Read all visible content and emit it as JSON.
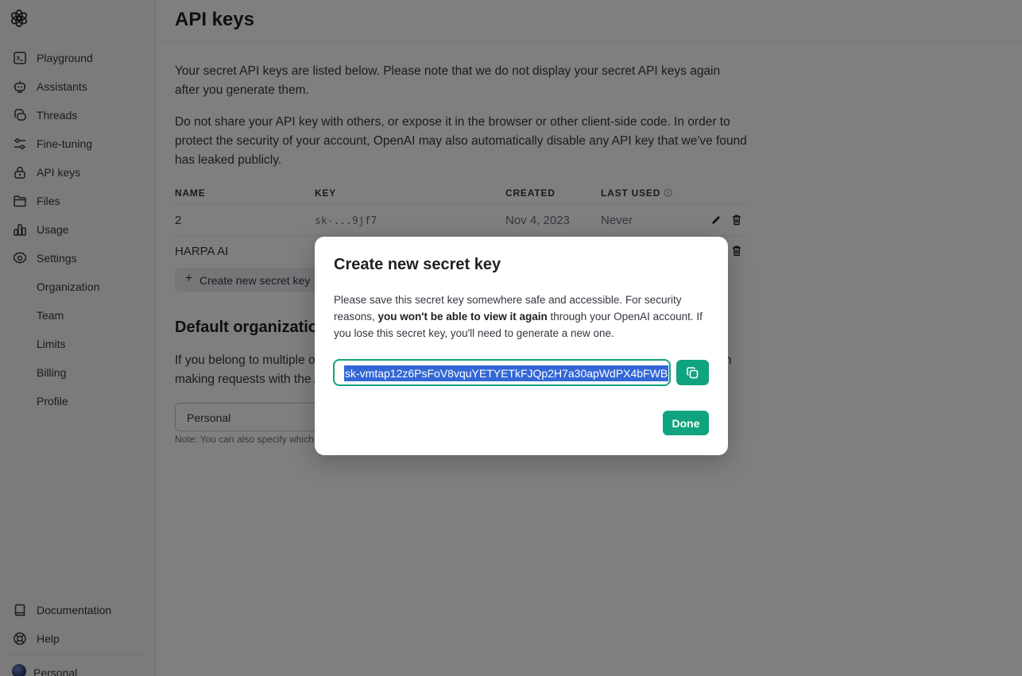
{
  "sidebar": {
    "logo": "openai-logo",
    "items": [
      {
        "label": "Playground",
        "icon": "terminal-icon"
      },
      {
        "label": "Assistants",
        "icon": "robot-icon"
      },
      {
        "label": "Threads",
        "icon": "chat-bubbles-icon"
      },
      {
        "label": "Fine-tuning",
        "icon": "sliders-icon"
      },
      {
        "label": "API keys",
        "icon": "lock-icon"
      },
      {
        "label": "Files",
        "icon": "folder-icon"
      },
      {
        "label": "Usage",
        "icon": "bar-chart-icon"
      },
      {
        "label": "Settings",
        "icon": "gear-icon"
      }
    ],
    "settings_sub": [
      {
        "label": "Organization"
      },
      {
        "label": "Team"
      },
      {
        "label": "Limits"
      },
      {
        "label": "Billing"
      },
      {
        "label": "Profile"
      }
    ],
    "bottom": [
      {
        "label": "Documentation",
        "icon": "book-icon"
      },
      {
        "label": "Help",
        "icon": "lifebuoy-icon"
      }
    ],
    "account": "Personal"
  },
  "page": {
    "title": "API keys",
    "paragraph1": "Your secret API keys are listed below. Please note that we do not display your secret API keys again after you generate them.",
    "paragraph2": "Do not share your API key with others, or expose it in the browser or other client-side code. In order to protect the security of your account, OpenAI may also automatically disable any API key that we've found has leaked publicly."
  },
  "table": {
    "headers": {
      "name": "NAME",
      "key": "KEY",
      "created": "CREATED",
      "last_used": "LAST USED"
    },
    "rows": [
      {
        "name": "2",
        "key": "sk-...9jf7",
        "created": "Nov 4, 2023",
        "last_used": "Never"
      },
      {
        "name": "HARPA AI",
        "key": "",
        "created": "",
        "last_used": ""
      }
    ]
  },
  "create_button": {
    "plus": "+",
    "label": "Create new secret key"
  },
  "default_org": {
    "title": "Default organization",
    "text": "If you belong to multiple organizations, this setting controls which organization is used by default when making requests with the API keys above.",
    "select_value": "Personal",
    "note": "Note: You can also specify which organization to use for each API request."
  },
  "modal": {
    "title": "Create new secret key",
    "text_before": "Please save this secret key somewhere safe and accessible. For security reasons, ",
    "text_bold": "you won't be able to view it again",
    "text_after": " through your OpenAI account. If you lose this secret key, you'll need to generate a new one.",
    "key_value": "sk-vmtap12z6PsFoV8vquYETYETkFJQp2H7a30apWdPX4bFWB",
    "done_label": "Done"
  },
  "colors": {
    "accent": "#10a37f",
    "selection": "#3367d6",
    "overlay": "rgba(0,0,0,0.5)"
  }
}
